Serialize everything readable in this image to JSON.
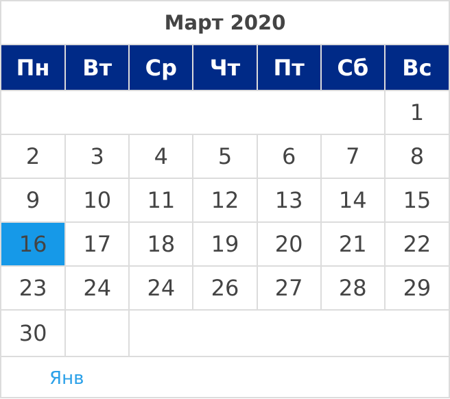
{
  "title": "Март 2020",
  "weekdays": [
    "Пн",
    "Вт",
    "Ср",
    "Чт",
    "Пт",
    "Сб",
    "Вс"
  ],
  "weeks": [
    [
      "",
      "",
      "",
      "",
      "",
      "",
      "1"
    ],
    [
      "2",
      "3",
      "4",
      "5",
      "6",
      "7",
      "8"
    ],
    [
      "9",
      "10",
      "11",
      "12",
      "13",
      "14",
      "15"
    ],
    [
      "16",
      "17",
      "18",
      "19",
      "20",
      "21",
      "22"
    ],
    [
      "23",
      "24",
      "24",
      "26",
      "27",
      "28",
      "29"
    ],
    [
      "30",
      "",
      "",
      "",
      "",
      "",
      ""
    ]
  ],
  "selected_day": "16",
  "footer_link": "Янв",
  "colors": {
    "header_bg": "#002a87",
    "selected_bg": "#1699e8",
    "link": "#2aa0e8"
  }
}
